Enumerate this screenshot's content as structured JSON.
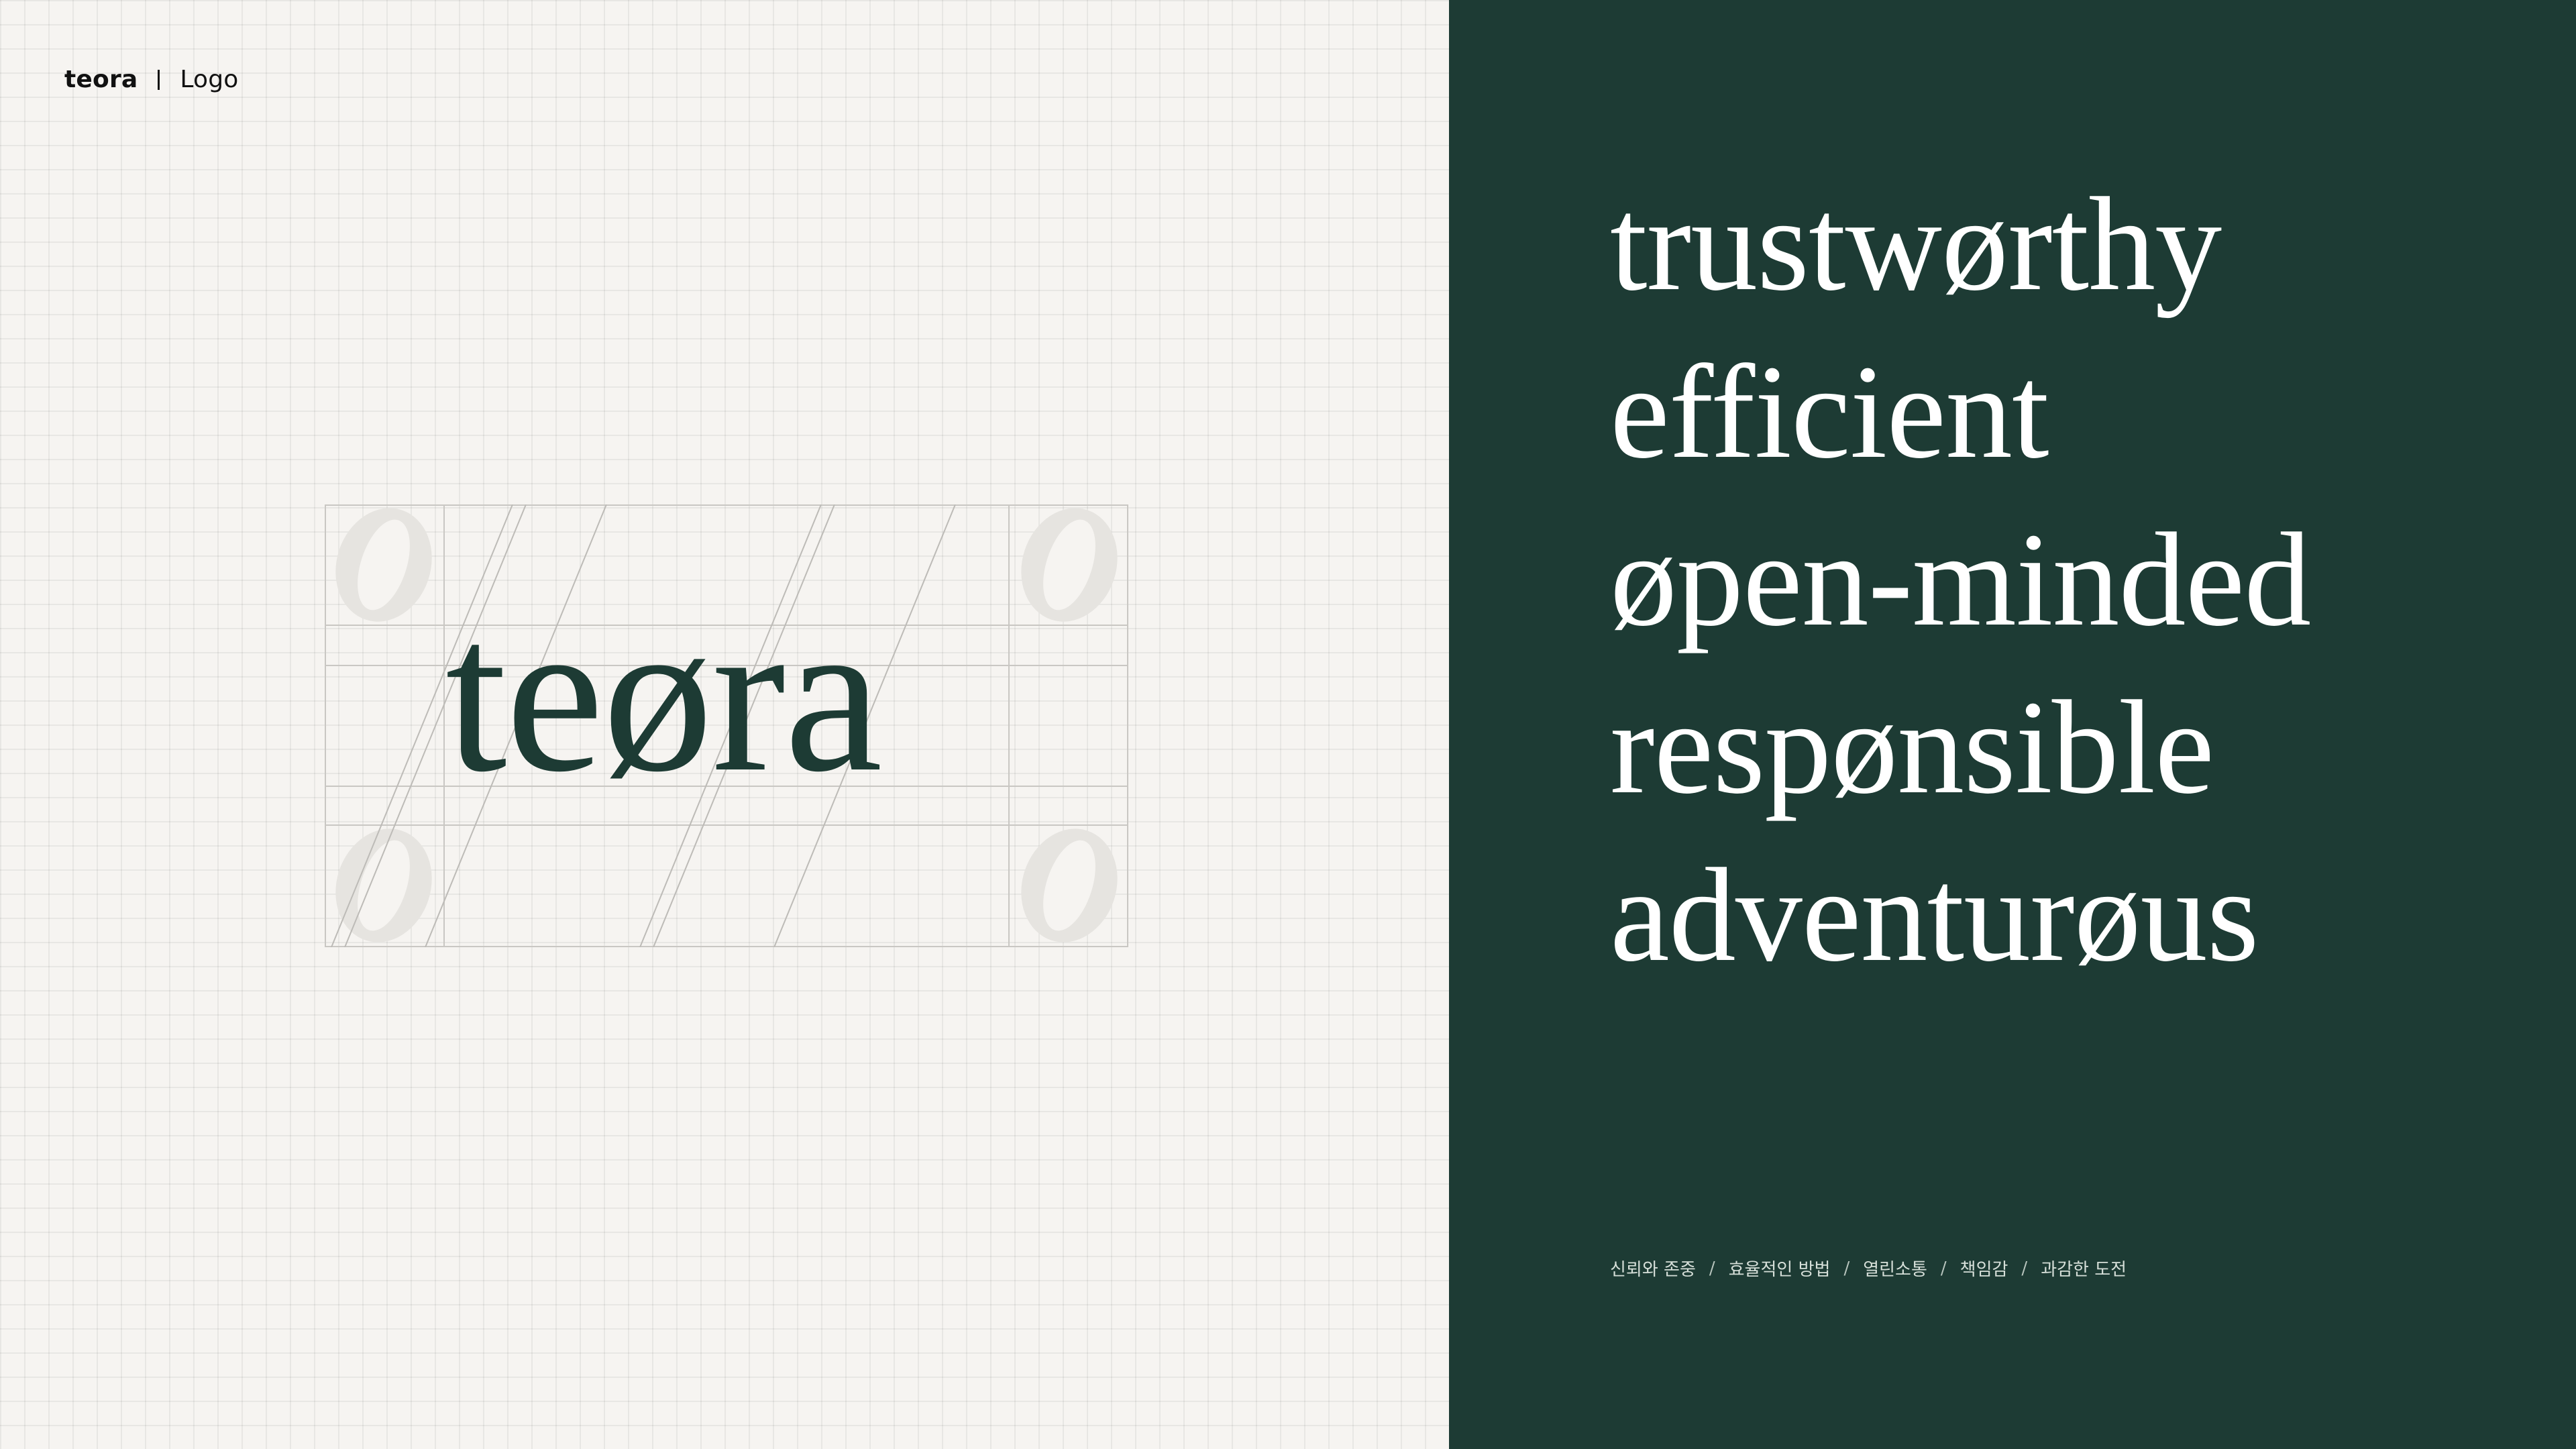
{
  "header": {
    "brand": "teora",
    "section": "Logo"
  },
  "logo": {
    "wordmark": "teøra"
  },
  "values": [
    "trustwørthy",
    "efficient",
    "øpen-minded",
    "respønsible",
    "adventurøus"
  ],
  "keywords": [
    "신뢰와 존중",
    "효율적인 방법",
    "열린소통",
    "책임감",
    "과감한 도전"
  ],
  "colors": {
    "brand_green": "#1d3b34",
    "paper": "#f6f4f1"
  }
}
